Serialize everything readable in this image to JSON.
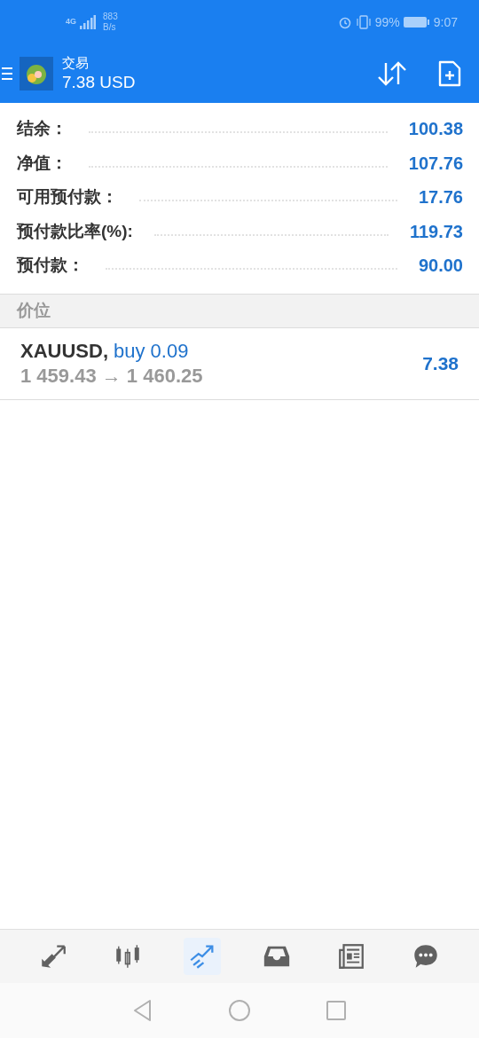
{
  "status_bar": {
    "network": "4G",
    "speed": "883",
    "speed_unit": "B/s",
    "battery": "99%",
    "time": "9:07"
  },
  "header": {
    "title": "交易",
    "subtitle": "7.38 USD"
  },
  "summary": [
    {
      "label": "结余：",
      "value": "100.38"
    },
    {
      "label": "净值：",
      "value": "107.76"
    },
    {
      "label": "可用预付款：",
      "value": "17.76"
    },
    {
      "label": "预付款比率(%):",
      "value": "119.73"
    },
    {
      "label": "预付款：",
      "value": "90.00"
    }
  ],
  "section": {
    "title": "价位"
  },
  "positions": [
    {
      "symbol": "XAUUSD,",
      "order": "buy 0.09",
      "prices": "1 459.43 → 1 460.25",
      "profit": "7.38"
    }
  ],
  "bottom_nav": [
    {
      "kind": "quotes",
      "selected": false
    },
    {
      "kind": "chart",
      "selected": false
    },
    {
      "kind": "trade",
      "selected": true
    },
    {
      "kind": "history",
      "selected": false
    },
    {
      "kind": "news",
      "selected": false
    },
    {
      "kind": "chat",
      "selected": false
    }
  ]
}
